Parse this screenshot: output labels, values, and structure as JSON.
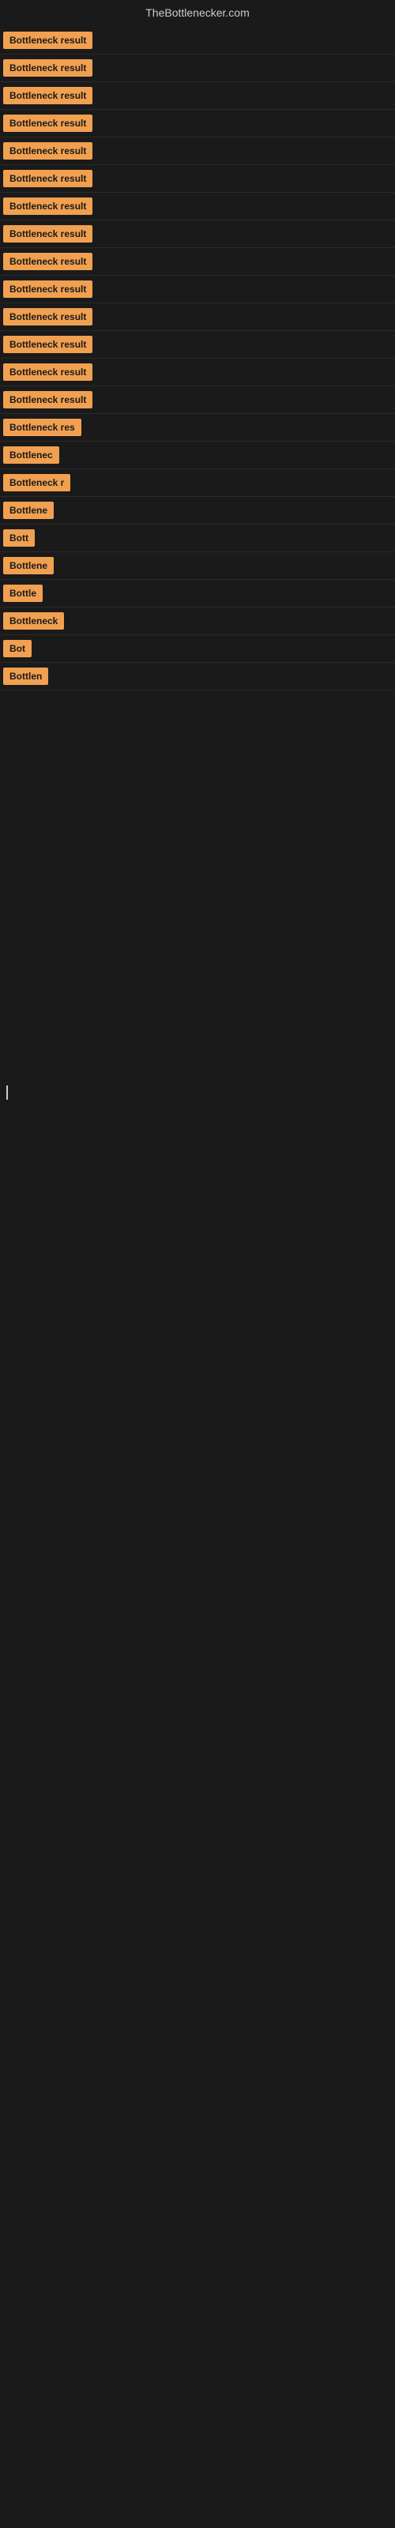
{
  "site": {
    "title": "TheBottlenecker.com"
  },
  "results": [
    {
      "id": 1,
      "label": "Bottleneck result",
      "width": 130
    },
    {
      "id": 2,
      "label": "Bottleneck result",
      "width": 130
    },
    {
      "id": 3,
      "label": "Bottleneck result",
      "width": 130
    },
    {
      "id": 4,
      "label": "Bottleneck result",
      "width": 130
    },
    {
      "id": 5,
      "label": "Bottleneck result",
      "width": 130
    },
    {
      "id": 6,
      "label": "Bottleneck result",
      "width": 130
    },
    {
      "id": 7,
      "label": "Bottleneck result",
      "width": 130
    },
    {
      "id": 8,
      "label": "Bottleneck result",
      "width": 130
    },
    {
      "id": 9,
      "label": "Bottleneck result",
      "width": 130
    },
    {
      "id": 10,
      "label": "Bottleneck result",
      "width": 130
    },
    {
      "id": 11,
      "label": "Bottleneck result",
      "width": 130
    },
    {
      "id": 12,
      "label": "Bottleneck result",
      "width": 130
    },
    {
      "id": 13,
      "label": "Bottleneck result",
      "width": 130
    },
    {
      "id": 14,
      "label": "Bottleneck result",
      "width": 130
    },
    {
      "id": 15,
      "label": "Bottleneck res",
      "width": 110
    },
    {
      "id": 16,
      "label": "Bottlenec",
      "width": 80
    },
    {
      "id": 17,
      "label": "Bottleneck r",
      "width": 90
    },
    {
      "id": 18,
      "label": "Bottlene",
      "width": 75
    },
    {
      "id": 19,
      "label": "Bott",
      "width": 42
    },
    {
      "id": 20,
      "label": "Bottlene",
      "width": 75
    },
    {
      "id": 21,
      "label": "Bottle",
      "width": 58
    },
    {
      "id": 22,
      "label": "Bottleneck",
      "width": 84
    },
    {
      "id": 23,
      "label": "Bot",
      "width": 36
    },
    {
      "id": 24,
      "label": "Bottlen",
      "width": 68
    }
  ]
}
